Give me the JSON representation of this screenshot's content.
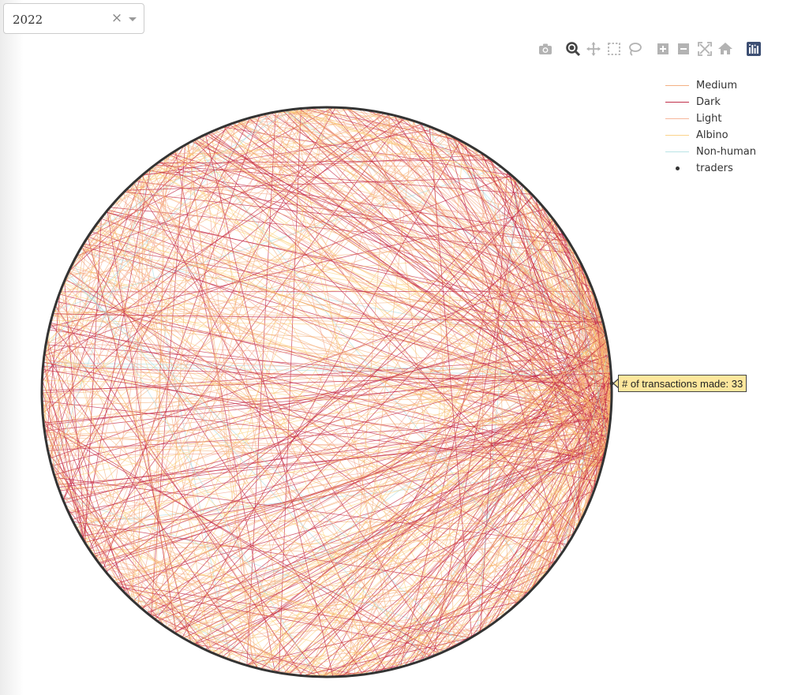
{
  "year_filter": {
    "selected": "2022",
    "clear_symbol": "×"
  },
  "modebar": {
    "buttons": [
      {
        "name": "camera-icon",
        "title": "Download plot as a png",
        "active": false
      },
      {
        "name": "zoom-icon",
        "title": "Zoom",
        "active": true
      },
      {
        "name": "pan-icon",
        "title": "Pan",
        "active": false
      },
      {
        "name": "box-select-icon",
        "title": "Box Select",
        "active": false
      },
      {
        "name": "lasso-select-icon",
        "title": "Lasso Select",
        "active": false
      },
      {
        "name": "zoom-in-icon",
        "title": "Zoom in",
        "active": false
      },
      {
        "name": "zoom-out-icon",
        "title": "Zoom out",
        "active": false
      },
      {
        "name": "autoscale-icon",
        "title": "Autoscale",
        "active": false
      },
      {
        "name": "reset-axes-icon",
        "title": "Reset axes",
        "active": false
      },
      {
        "name": "plotly-logo-icon",
        "title": "Produced with Plotly",
        "active": false
      }
    ]
  },
  "legend": {
    "items": [
      {
        "label": "Medium",
        "kind": "line",
        "color": "#f4b183"
      },
      {
        "label": "Dark",
        "kind": "line",
        "color": "#c0304a"
      },
      {
        "label": "Light",
        "kind": "line",
        "color": "#f7b79b"
      },
      {
        "label": "Albino",
        "kind": "line",
        "color": "#fbd38a"
      },
      {
        "label": "Non-human",
        "kind": "line",
        "color": "#b9e3e6"
      },
      {
        "label": "traders",
        "kind": "marker",
        "color": "#333333"
      }
    ]
  },
  "tooltip": {
    "text": "# of transactions made: 33"
  },
  "chart_data": {
    "type": "network",
    "layout": "circular",
    "node_trace": "traders",
    "edge_groups": [
      "Medium",
      "Dark",
      "Light",
      "Albino",
      "Non-human"
    ],
    "edge_colors": {
      "Medium": "#f4a76b",
      "Dark": "#c42a45",
      "Light": "#f39a7e",
      "Albino": "#fbcf6e",
      "Non-human": "#9fd6dc"
    },
    "node_color": "#333333",
    "hovered_node_transactions": 33
  }
}
